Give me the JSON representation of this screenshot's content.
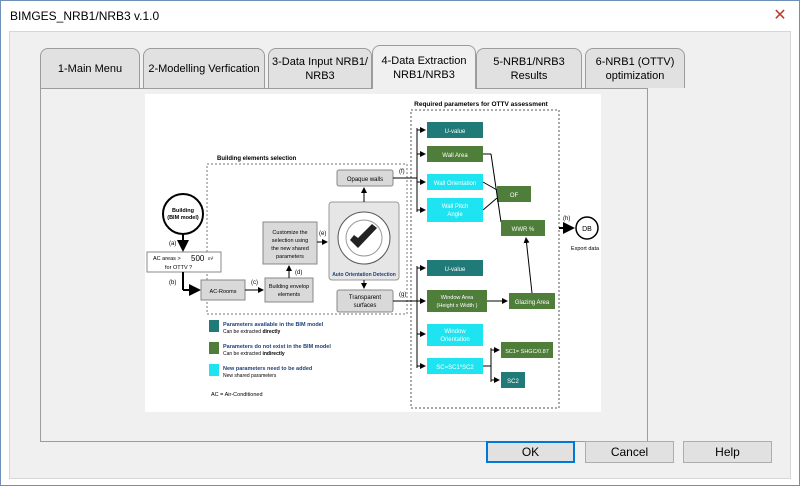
{
  "window": {
    "title": "BIMGES_NRB1/NRB3 v.1.0"
  },
  "tabs": [
    {
      "label": "1-Main Menu"
    },
    {
      "label": "2-Modelling Verfication"
    },
    {
      "label_line1": "3-Data Input NRB1/",
      "label_line2": "NRB3"
    },
    {
      "label_line1": "4-Data Extraction",
      "label_line2": "NRB1/NRB3"
    },
    {
      "label": "5-NRB1/NRB3 Results"
    },
    {
      "label_line1": "6-NRB1 (OTTV)",
      "label_line2": "optimization"
    }
  ],
  "buttons": {
    "ok": "OK",
    "cancel": "Cancel",
    "help": "Help"
  },
  "figure": {
    "heading": "Required parameters for OTTV assessment",
    "section_label": "Building elements selection",
    "building_line1": "Building",
    "building_line2": "(BIM model)",
    "step_a": "(a)",
    "step_b": "(b)",
    "step_c": "(c)",
    "step_d": "(d)",
    "step_e": "(e)",
    "step_f": "(f)",
    "step_g": "(g)",
    "step_h": "(h)",
    "ac_line1": "AC  areas  >",
    "ac_value": "500",
    "ac_unit": "m²",
    "ac_line2": "for OTTV ?",
    "ac_rooms": "AC-Rooms",
    "envelope_line1": "Building envelop",
    "envelope_line2": "elements",
    "customize_line1": "Customize the",
    "customize_line2": "selection using",
    "customize_line3": "the new shared",
    "customize_line4": "parameters",
    "opaque_walls": "Opaque walls",
    "transparent_line1": "Transparent",
    "transparent_line2": "surfaces",
    "auto_orientation": "Auto Orientation Detection",
    "u_value_1": "U-value",
    "wall_area": "Wall Area",
    "wall_orientation": "Wall Orientation",
    "wall_pitch_line1": "Wall Pitch",
    "wall_pitch_line2": "Angle",
    "of": "OF",
    "wwr": "WWR %",
    "db": "DB",
    "export": "Export data",
    "u_value_2": "U-value",
    "window_area_line1": "Window Area",
    "window_area_line2": "(Height x Width )",
    "glazing_area": "Glazing Area",
    "window_orient_line1": "Window",
    "window_orient_line2": "Orientation",
    "sc": "SC=SC1*SC2",
    "sc1": "SC1= SHGC/0.87",
    "sc2": "SC2",
    "legend_1_title": "Parameters available in the BIM model",
    "legend_1_sub_a": "Can be extracted ",
    "legend_1_sub_b": "directly",
    "legend_2_title": "Parameters do not exist in the BIM model",
    "legend_2_sub_a": "Can be extracted ",
    "legend_2_sub_b": "indirectly",
    "legend_3_title": "New parameters need to be added",
    "legend_3_sub": "New shared parameters",
    "ac_note": "AC = Air-Conditioned",
    "colors": {
      "teal": "#1f7a78",
      "green": "#4f7d3a",
      "cyan": "#1ee3f0"
    }
  }
}
